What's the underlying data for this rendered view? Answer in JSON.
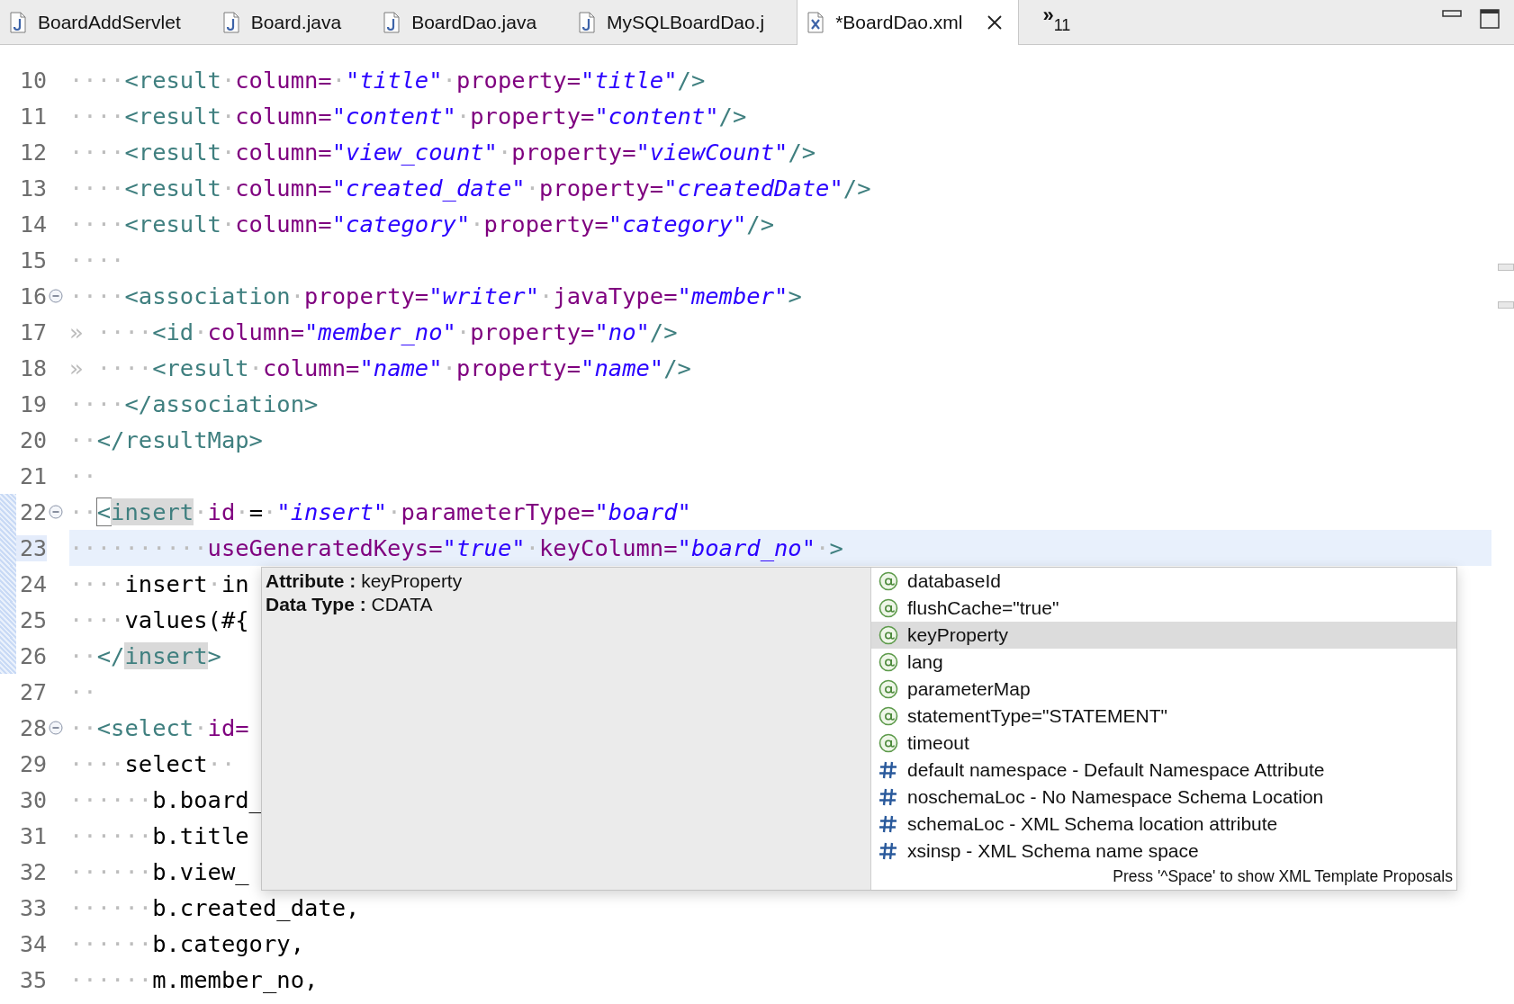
{
  "tabs": [
    {
      "label": "BoardAddServlet",
      "kind": "java",
      "selected": false
    },
    {
      "label": "Board.java",
      "kind": "java",
      "selected": false
    },
    {
      "label": "BoardDao.java",
      "kind": "java",
      "selected": false
    },
    {
      "label": "MySQLBoardDao.j",
      "kind": "java",
      "selected": false
    },
    {
      "label": "*BoardDao.xml",
      "kind": "xml",
      "selected": true
    }
  ],
  "overflow": {
    "icon": "»",
    "count": "11"
  },
  "editor": {
    "lines": [
      {
        "number": "10",
        "current": false,
        "changed": false,
        "fold": false,
        "tokens": [
          {
            "kind": "ws",
            "text": "····"
          },
          {
            "kind": "tag",
            "text": "<result"
          },
          {
            "kind": "ws",
            "text": "·"
          },
          {
            "kind": "attr",
            "text": "column="
          },
          {
            "kind": "ws",
            "text": "·"
          },
          {
            "kind": "str",
            "text": "\"title\""
          },
          {
            "kind": "ws",
            "text": "·"
          },
          {
            "kind": "attr",
            "text": "property="
          },
          {
            "kind": "str",
            "text": "\"title\""
          },
          {
            "kind": "tag",
            "text": "/>"
          }
        ]
      },
      {
        "number": "11",
        "current": false,
        "changed": false,
        "fold": false,
        "tokens": [
          {
            "kind": "ws",
            "text": "····"
          },
          {
            "kind": "tag",
            "text": "<result"
          },
          {
            "kind": "ws",
            "text": "·"
          },
          {
            "kind": "attr",
            "text": "column="
          },
          {
            "kind": "str",
            "text": "\"content\""
          },
          {
            "kind": "ws",
            "text": "·"
          },
          {
            "kind": "attr",
            "text": "property="
          },
          {
            "kind": "str",
            "text": "\"content\""
          },
          {
            "kind": "tag",
            "text": "/>"
          }
        ]
      },
      {
        "number": "12",
        "current": false,
        "changed": false,
        "fold": false,
        "tokens": [
          {
            "kind": "ws",
            "text": "····"
          },
          {
            "kind": "tag",
            "text": "<result"
          },
          {
            "kind": "ws",
            "text": "·"
          },
          {
            "kind": "attr",
            "text": "column="
          },
          {
            "kind": "str",
            "text": "\"view_count\""
          },
          {
            "kind": "ws",
            "text": "·"
          },
          {
            "kind": "attr",
            "text": "property="
          },
          {
            "kind": "str",
            "text": "\"viewCount\""
          },
          {
            "kind": "tag",
            "text": "/>"
          }
        ]
      },
      {
        "number": "13",
        "current": false,
        "changed": false,
        "fold": false,
        "tokens": [
          {
            "kind": "ws",
            "text": "····"
          },
          {
            "kind": "tag",
            "text": "<result"
          },
          {
            "kind": "ws",
            "text": "·"
          },
          {
            "kind": "attr",
            "text": "column="
          },
          {
            "kind": "str",
            "text": "\"created_date\""
          },
          {
            "kind": "ws",
            "text": "·"
          },
          {
            "kind": "attr",
            "text": "property="
          },
          {
            "kind": "str",
            "text": "\"createdDate\""
          },
          {
            "kind": "tag",
            "text": "/>"
          }
        ]
      },
      {
        "number": "14",
        "current": false,
        "changed": false,
        "fold": false,
        "tokens": [
          {
            "kind": "ws",
            "text": "····"
          },
          {
            "kind": "tag",
            "text": "<result"
          },
          {
            "kind": "ws",
            "text": "·"
          },
          {
            "kind": "attr",
            "text": "column="
          },
          {
            "kind": "str",
            "text": "\"category\""
          },
          {
            "kind": "ws",
            "text": "·"
          },
          {
            "kind": "attr",
            "text": "property="
          },
          {
            "kind": "str",
            "text": "\"category\""
          },
          {
            "kind": "tag",
            "text": "/>"
          }
        ]
      },
      {
        "number": "15",
        "current": false,
        "changed": false,
        "fold": false,
        "tokens": [
          {
            "kind": "ws",
            "text": "····"
          }
        ]
      },
      {
        "number": "16",
        "current": false,
        "changed": false,
        "fold": true,
        "tokens": [
          {
            "kind": "ws",
            "text": "····"
          },
          {
            "kind": "tag",
            "text": "<association"
          },
          {
            "kind": "ws",
            "text": "·"
          },
          {
            "kind": "attr",
            "text": "property="
          },
          {
            "kind": "str",
            "text": "\"writer\""
          },
          {
            "kind": "ws",
            "text": "·"
          },
          {
            "kind": "attr",
            "text": "javaType="
          },
          {
            "kind": "str",
            "text": "\"member\""
          },
          {
            "kind": "tag",
            "text": ">"
          }
        ]
      },
      {
        "number": "17",
        "current": false,
        "changed": false,
        "fold": false,
        "tokens": [
          {
            "kind": "ws",
            "text": "» ····"
          },
          {
            "kind": "tag",
            "text": "<id"
          },
          {
            "kind": "ws",
            "text": "·"
          },
          {
            "kind": "attr",
            "text": "column="
          },
          {
            "kind": "str",
            "text": "\"member_no\""
          },
          {
            "kind": "ws",
            "text": "·"
          },
          {
            "kind": "attr",
            "text": "property="
          },
          {
            "kind": "str",
            "text": "\"no\""
          },
          {
            "kind": "tag",
            "text": "/>"
          }
        ]
      },
      {
        "number": "18",
        "current": false,
        "changed": false,
        "fold": false,
        "tokens": [
          {
            "kind": "ws",
            "text": "» ····"
          },
          {
            "kind": "tag",
            "text": "<result"
          },
          {
            "kind": "ws",
            "text": "·"
          },
          {
            "kind": "attr",
            "text": "column="
          },
          {
            "kind": "str",
            "text": "\"name\""
          },
          {
            "kind": "ws",
            "text": "·"
          },
          {
            "kind": "attr",
            "text": "property="
          },
          {
            "kind": "str",
            "text": "\"name\""
          },
          {
            "kind": "tag",
            "text": "/>"
          }
        ]
      },
      {
        "number": "19",
        "current": false,
        "changed": false,
        "fold": false,
        "tokens": [
          {
            "kind": "ws",
            "text": "····"
          },
          {
            "kind": "tag",
            "text": "</association>"
          }
        ]
      },
      {
        "number": "20",
        "current": false,
        "changed": false,
        "fold": false,
        "tokens": [
          {
            "kind": "ws",
            "text": "··"
          },
          {
            "kind": "tag",
            "text": "</resultMap>"
          }
        ]
      },
      {
        "number": "21",
        "current": false,
        "changed": false,
        "fold": false,
        "tokens": [
          {
            "kind": "ws",
            "text": "··"
          }
        ]
      },
      {
        "number": "22",
        "current": false,
        "changed": true,
        "fold": true,
        "tokens": [
          {
            "kind": "ws",
            "text": "··"
          },
          {
            "kind": "cursor",
            "text": "<"
          },
          {
            "kind": "match",
            "text": "insert"
          },
          {
            "kind": "ws",
            "text": "·"
          },
          {
            "kind": "attr",
            "text": "id"
          },
          {
            "kind": "ws",
            "text": "·"
          },
          {
            "kind": "text",
            "text": "="
          },
          {
            "kind": "ws",
            "text": "·"
          },
          {
            "kind": "str",
            "text": "\"insert\""
          },
          {
            "kind": "ws",
            "text": "·"
          },
          {
            "kind": "attr",
            "text": "parameterType="
          },
          {
            "kind": "str",
            "text": "\"board\""
          }
        ]
      },
      {
        "number": "23",
        "current": true,
        "changed": true,
        "fold": false,
        "tokens": [
          {
            "kind": "ws",
            "text": "··········"
          },
          {
            "kind": "attr",
            "text": "useGeneratedKeys="
          },
          {
            "kind": "str",
            "text": "\"true\""
          },
          {
            "kind": "ws",
            "text": "·"
          },
          {
            "kind": "attr",
            "text": "keyColumn="
          },
          {
            "kind": "str",
            "text": "\"board_no\""
          },
          {
            "kind": "ws",
            "text": "·"
          },
          {
            "kind": "tag",
            "text": ">"
          }
        ]
      },
      {
        "number": "24",
        "current": false,
        "changed": true,
        "fold": false,
        "tokens": [
          {
            "kind": "ws",
            "text": "····"
          },
          {
            "kind": "text",
            "text": "insert"
          },
          {
            "kind": "ws",
            "text": "·"
          },
          {
            "kind": "text",
            "text": "in"
          }
        ]
      },
      {
        "number": "25",
        "current": false,
        "changed": true,
        "fold": false,
        "tokens": [
          {
            "kind": "ws",
            "text": "····"
          },
          {
            "kind": "text",
            "text": "values(#{"
          }
        ]
      },
      {
        "number": "26",
        "current": false,
        "changed": true,
        "fold": false,
        "tokens": [
          {
            "kind": "ws",
            "text": "··"
          },
          {
            "kind": "tag",
            "text": "</"
          },
          {
            "kind": "match",
            "text": "insert"
          },
          {
            "kind": "tag",
            "text": ">"
          }
        ]
      },
      {
        "number": "27",
        "current": false,
        "changed": false,
        "fold": false,
        "tokens": [
          {
            "kind": "ws",
            "text": "··"
          }
        ]
      },
      {
        "number": "28",
        "current": false,
        "changed": false,
        "fold": true,
        "tokens": [
          {
            "kind": "ws",
            "text": "··"
          },
          {
            "kind": "tag",
            "text": "<select"
          },
          {
            "kind": "ws",
            "text": "·"
          },
          {
            "kind": "attr",
            "text": "id="
          }
        ]
      },
      {
        "number": "29",
        "current": false,
        "changed": false,
        "fold": false,
        "tokens": [
          {
            "kind": "ws",
            "text": "····"
          },
          {
            "kind": "text",
            "text": "select"
          },
          {
            "kind": "ws",
            "text": "··"
          }
        ]
      },
      {
        "number": "30",
        "current": false,
        "changed": false,
        "fold": false,
        "tokens": [
          {
            "kind": "ws",
            "text": "······"
          },
          {
            "kind": "text",
            "text": "b.board_"
          }
        ]
      },
      {
        "number": "31",
        "current": false,
        "changed": false,
        "fold": false,
        "tokens": [
          {
            "kind": "ws",
            "text": "······"
          },
          {
            "kind": "text",
            "text": "b.title"
          }
        ]
      },
      {
        "number": "32",
        "current": false,
        "changed": false,
        "fold": false,
        "tokens": [
          {
            "kind": "ws",
            "text": "······"
          },
          {
            "kind": "text",
            "text": "b.view_"
          }
        ]
      },
      {
        "number": "33",
        "current": false,
        "changed": false,
        "fold": false,
        "tokens": [
          {
            "kind": "ws",
            "text": "······"
          },
          {
            "kind": "text",
            "text": "b.created_date,"
          }
        ]
      },
      {
        "number": "34",
        "current": false,
        "changed": false,
        "fold": false,
        "tokens": [
          {
            "kind": "ws",
            "text": "······"
          },
          {
            "kind": "text",
            "text": "b.category,"
          }
        ]
      },
      {
        "number": "35",
        "current": false,
        "changed": false,
        "fold": false,
        "tokens": [
          {
            "kind": "ws",
            "text": "······"
          },
          {
            "kind": "text",
            "text": "m.member_no,"
          }
        ]
      }
    ]
  },
  "content_assist": {
    "info": [
      "**Attribute :** keyProperty",
      "**Data Type :** CDATA"
    ],
    "proposals": [
      {
        "label": "databaseId",
        "kind": "attribute",
        "selected": false
      },
      {
        "label": "flushCache=\"true\"",
        "kind": "attribute",
        "selected": false
      },
      {
        "label": "keyProperty",
        "kind": "attribute",
        "selected": true
      },
      {
        "label": "lang",
        "kind": "attribute",
        "selected": false
      },
      {
        "label": "parameterMap",
        "kind": "attribute",
        "selected": false
      },
      {
        "label": "statementType=\"STATEMENT\"",
        "kind": "attribute",
        "selected": false
      },
      {
        "label": "timeout",
        "kind": "attribute",
        "selected": false
      },
      {
        "label": "default namespace - Default Namespace Attribute",
        "kind": "namespace",
        "selected": false
      },
      {
        "label": "noschemaLoc - No Namespace Schema Location",
        "kind": "namespace",
        "selected": false
      },
      {
        "label": "schemaLoc - XML Schema location attribute",
        "kind": "namespace",
        "selected": false
      },
      {
        "label": "xsinsp - XML Schema name space",
        "kind": "namespace",
        "selected": false
      }
    ],
    "hint": "Press '^Space' to show XML Template Proposals"
  }
}
